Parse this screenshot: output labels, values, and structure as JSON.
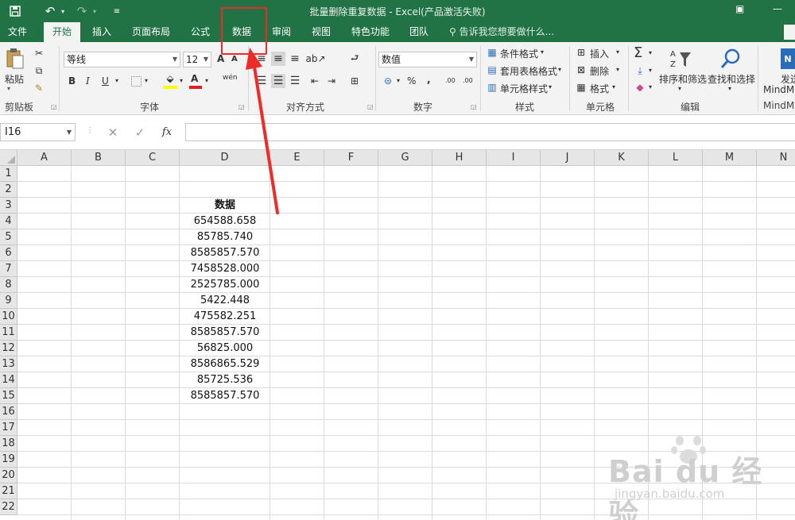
{
  "window": {
    "title": "批量删除重复数据 - Excel(产品激活失败)"
  },
  "tabs": [
    {
      "label": "文件"
    },
    {
      "label": "开始"
    },
    {
      "label": "插入"
    },
    {
      "label": "页面布局"
    },
    {
      "label": "公式"
    },
    {
      "label": "数据"
    },
    {
      "label": "审阅"
    },
    {
      "label": "视图"
    },
    {
      "label": "特色功能"
    },
    {
      "label": "团队"
    }
  ],
  "tell_me": {
    "text": "告诉我您想要做什么..."
  },
  "ribbon": {
    "clipboard": {
      "paste": "粘贴",
      "label": "剪贴板"
    },
    "font": {
      "family": "等线",
      "size": "12",
      "bold": "B",
      "italic": "I",
      "underline": "U",
      "grow": "A",
      "shrink": "A",
      "color": "A",
      "phonetic": "wén",
      "label": "字体"
    },
    "alignment": {
      "label": "对齐方式"
    },
    "number": {
      "format": "数值",
      "percent": "%",
      "comma": ",",
      "inc_decimal": ".00",
      "dec_decimal": ".00",
      "label": "数字"
    },
    "styles": {
      "conditional": "条件格式",
      "table": "套用表格格式",
      "cell": "单元格样式",
      "label": "样式"
    },
    "cells": {
      "insert": "插入",
      "delete": "删除",
      "format": "格式",
      "label": "单元格"
    },
    "editing": {
      "sum": "Σ",
      "sort": "排序和筛选",
      "find": "查找和选择",
      "label": "编辑"
    },
    "mindmap": {
      "send": "发送",
      "name_top": "MindM",
      "label": "MindM"
    }
  },
  "formula_bar": {
    "name_box": "I16",
    "cancel": "✕",
    "enter": "✓",
    "fx": "fx",
    "value": ""
  },
  "sheet": {
    "columns": [
      "A",
      "B",
      "C",
      "D",
      "E",
      "F",
      "G",
      "H",
      "I",
      "J",
      "K",
      "L",
      "M",
      "N"
    ],
    "rows": [
      "1",
      "2",
      "3",
      "4",
      "5",
      "6",
      "7",
      "8",
      "9",
      "10",
      "11",
      "12",
      "13",
      "14",
      "15",
      "16",
      "17",
      "18",
      "19",
      "20",
      "21",
      "22"
    ],
    "header": "数据",
    "values": [
      "654588.658",
      "85785.740",
      "8585857.570",
      "7458528.000",
      "2525785.000",
      "5422.448",
      "475582.251",
      "8585857.570",
      "56825.000",
      "8586865.529",
      "85725.536",
      "8585857.570"
    ]
  },
  "watermark": {
    "line1": "Bai du 经验",
    "line2": "jingyan.baidu.com"
  },
  "colors": {
    "excel_green": "#217346",
    "annotation_red": "#ee2b2b"
  }
}
